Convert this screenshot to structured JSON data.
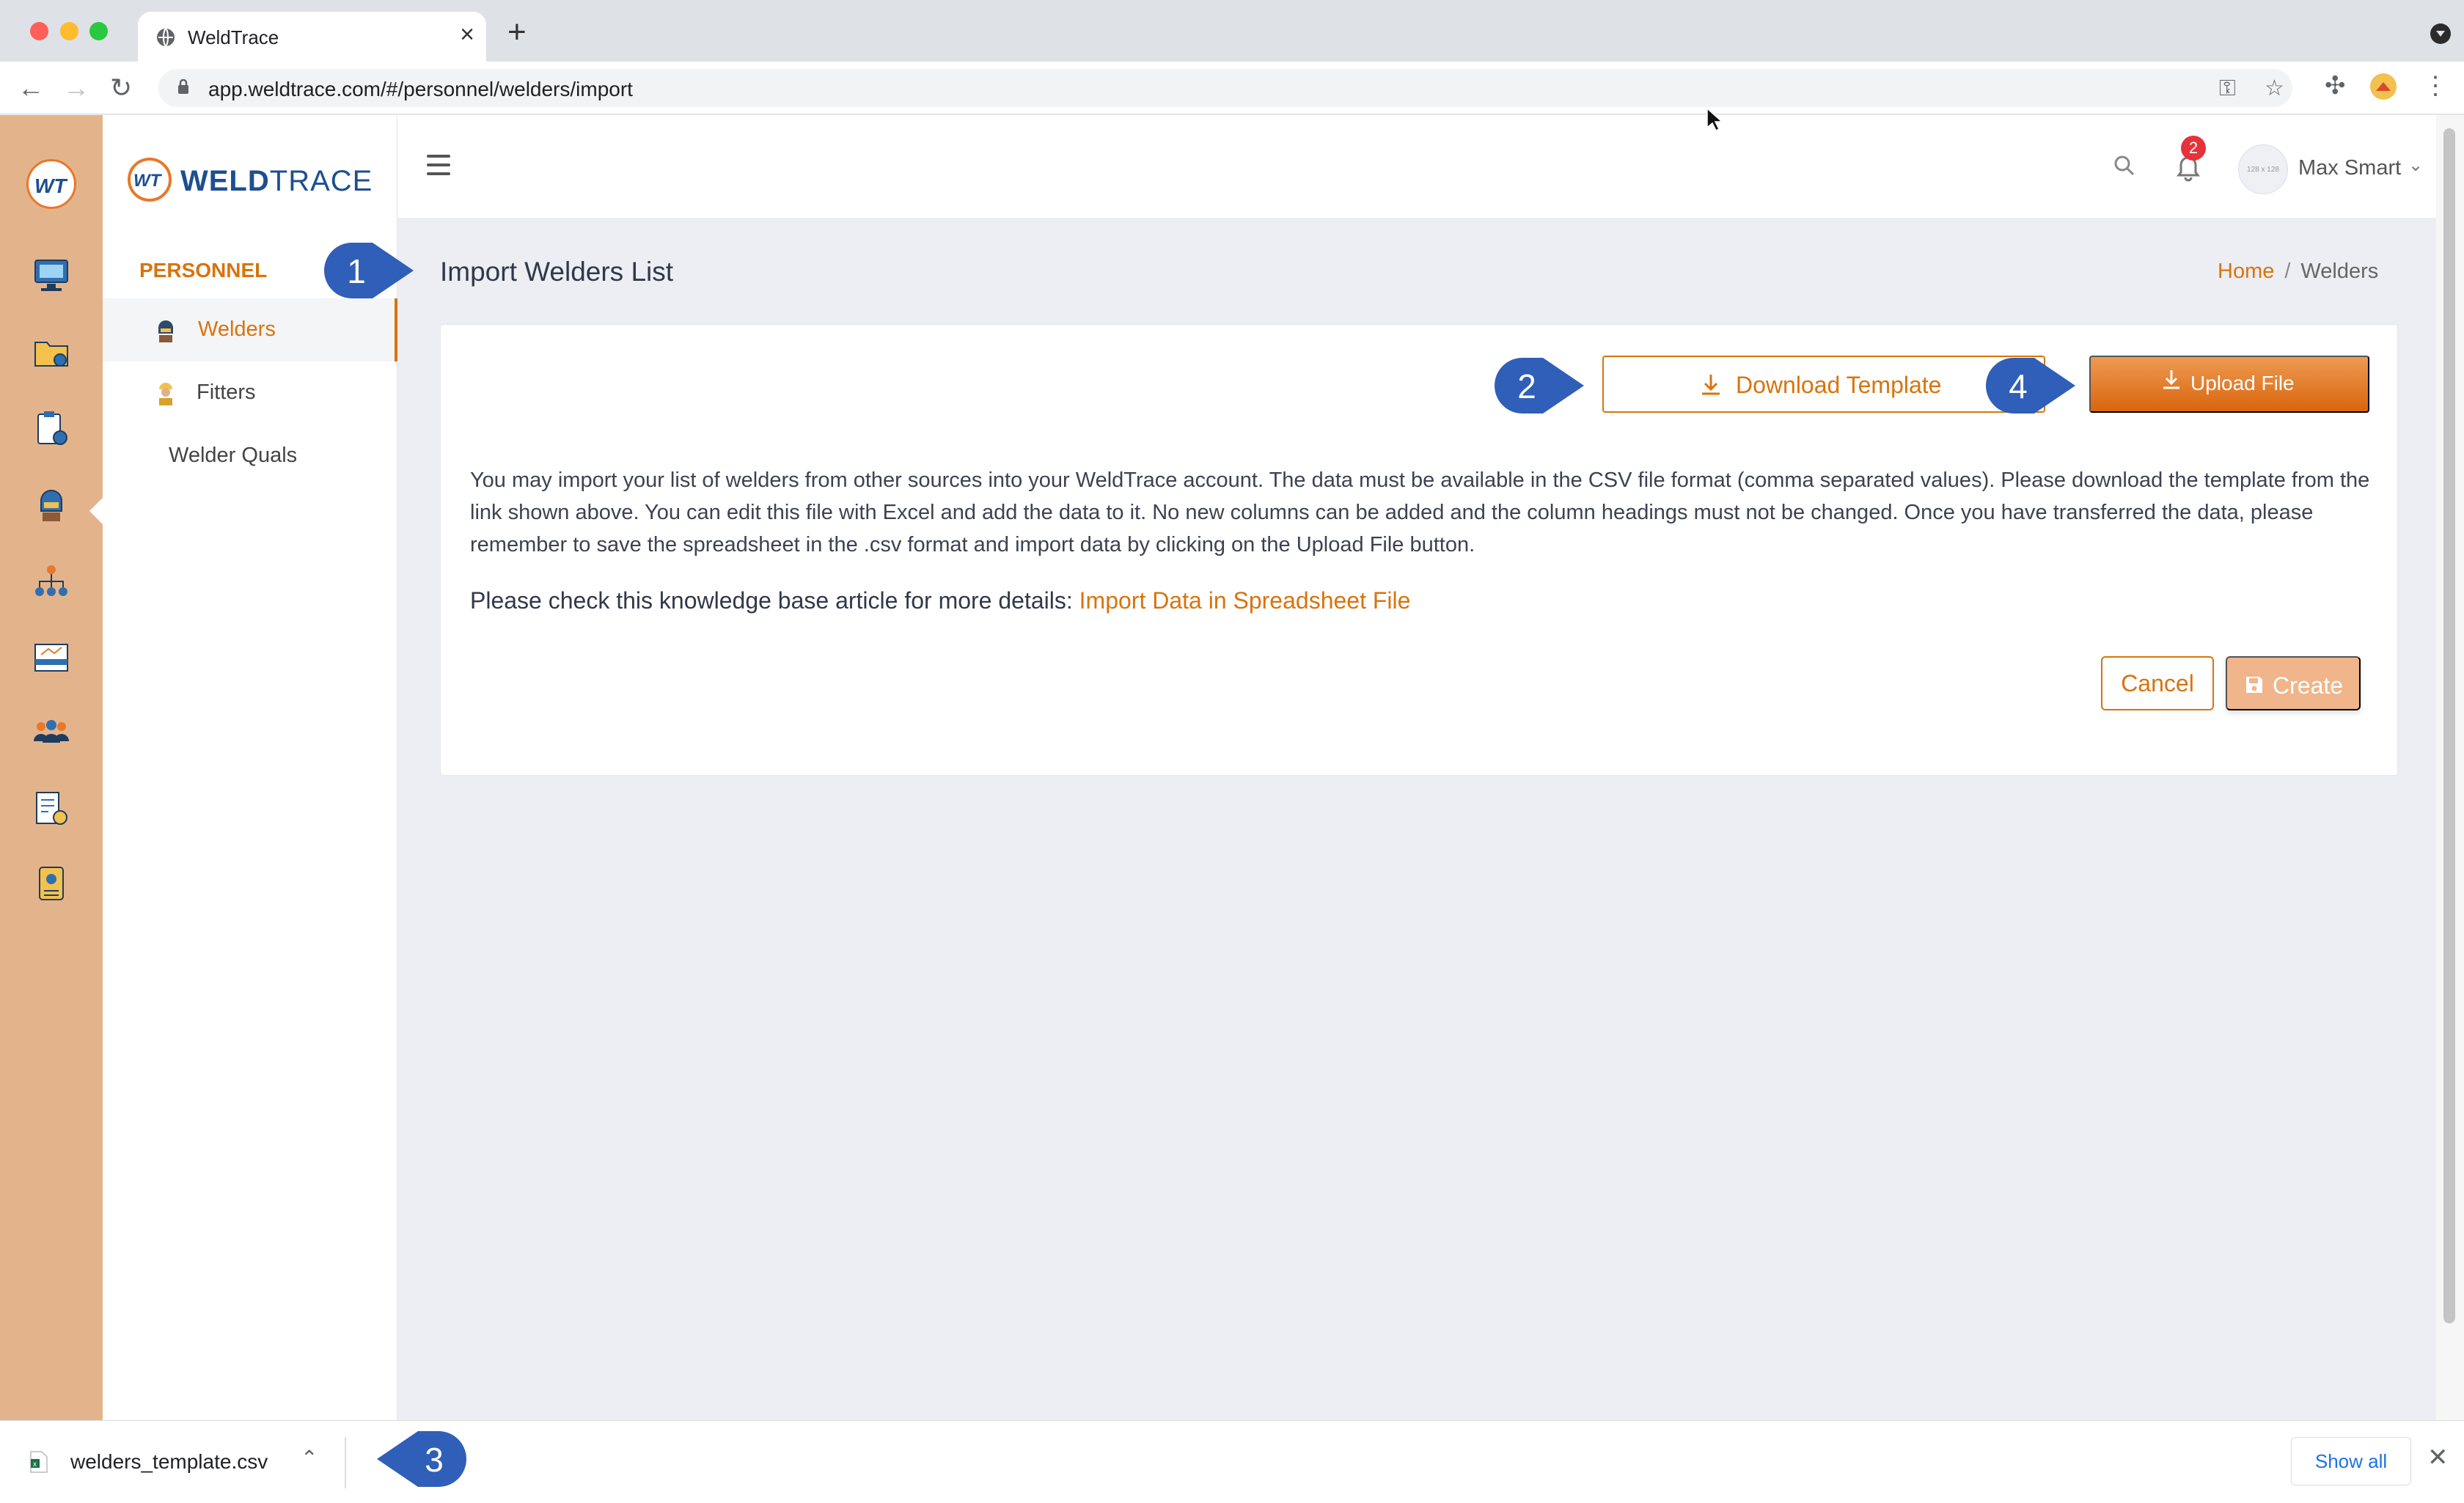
{
  "browser": {
    "tab_title": "WeldTrace",
    "url": "app.weldtrace.com/#/personnel/welders/import"
  },
  "brand": {
    "weld": "WELD",
    "trace": "TRACE"
  },
  "sidebar": {
    "section_title": "PERSONNEL",
    "items": [
      {
        "label": "Welders",
        "active": true
      },
      {
        "label": "Fitters",
        "active": false
      },
      {
        "label": "Welder Quals",
        "active": false
      }
    ]
  },
  "header": {
    "notification_count": "2",
    "avatar_placeholder": "128 x 128",
    "user_name": "Max Smart"
  },
  "page": {
    "title": "Import Welders List",
    "breadcrumb": {
      "home": "Home",
      "separator": "/",
      "current": "Welders"
    }
  },
  "card": {
    "download_label": "Download Template",
    "upload_label": "Upload File",
    "description": "You may import your list of welders from other sources into your WeldTrace account. The data must be available in the CSV file format (comma separated values). Please download the template from the link shown above. You can edit this file with Excel and add the data to it. No new columns can be added and the column headings must not be changed. Once you have transferred the data, please remember to save the spreadsheet in the .csv format and import data by clicking on the Upload File button.",
    "kb_prefix": "Please check this knowledge base article for more details: ",
    "kb_link": "Import Data in Spreadsheet File",
    "cancel_label": "Cancel",
    "create_label": "Create"
  },
  "download_bar": {
    "file_name": "welders_template.csv",
    "show_all": "Show all"
  },
  "callouts": [
    "1",
    "2",
    "3",
    "4"
  ],
  "colors": {
    "accent": "#d9730d",
    "rail": "#e3b48c",
    "callout": "#2f5fb8",
    "brand_blue": "#1d4f91"
  }
}
